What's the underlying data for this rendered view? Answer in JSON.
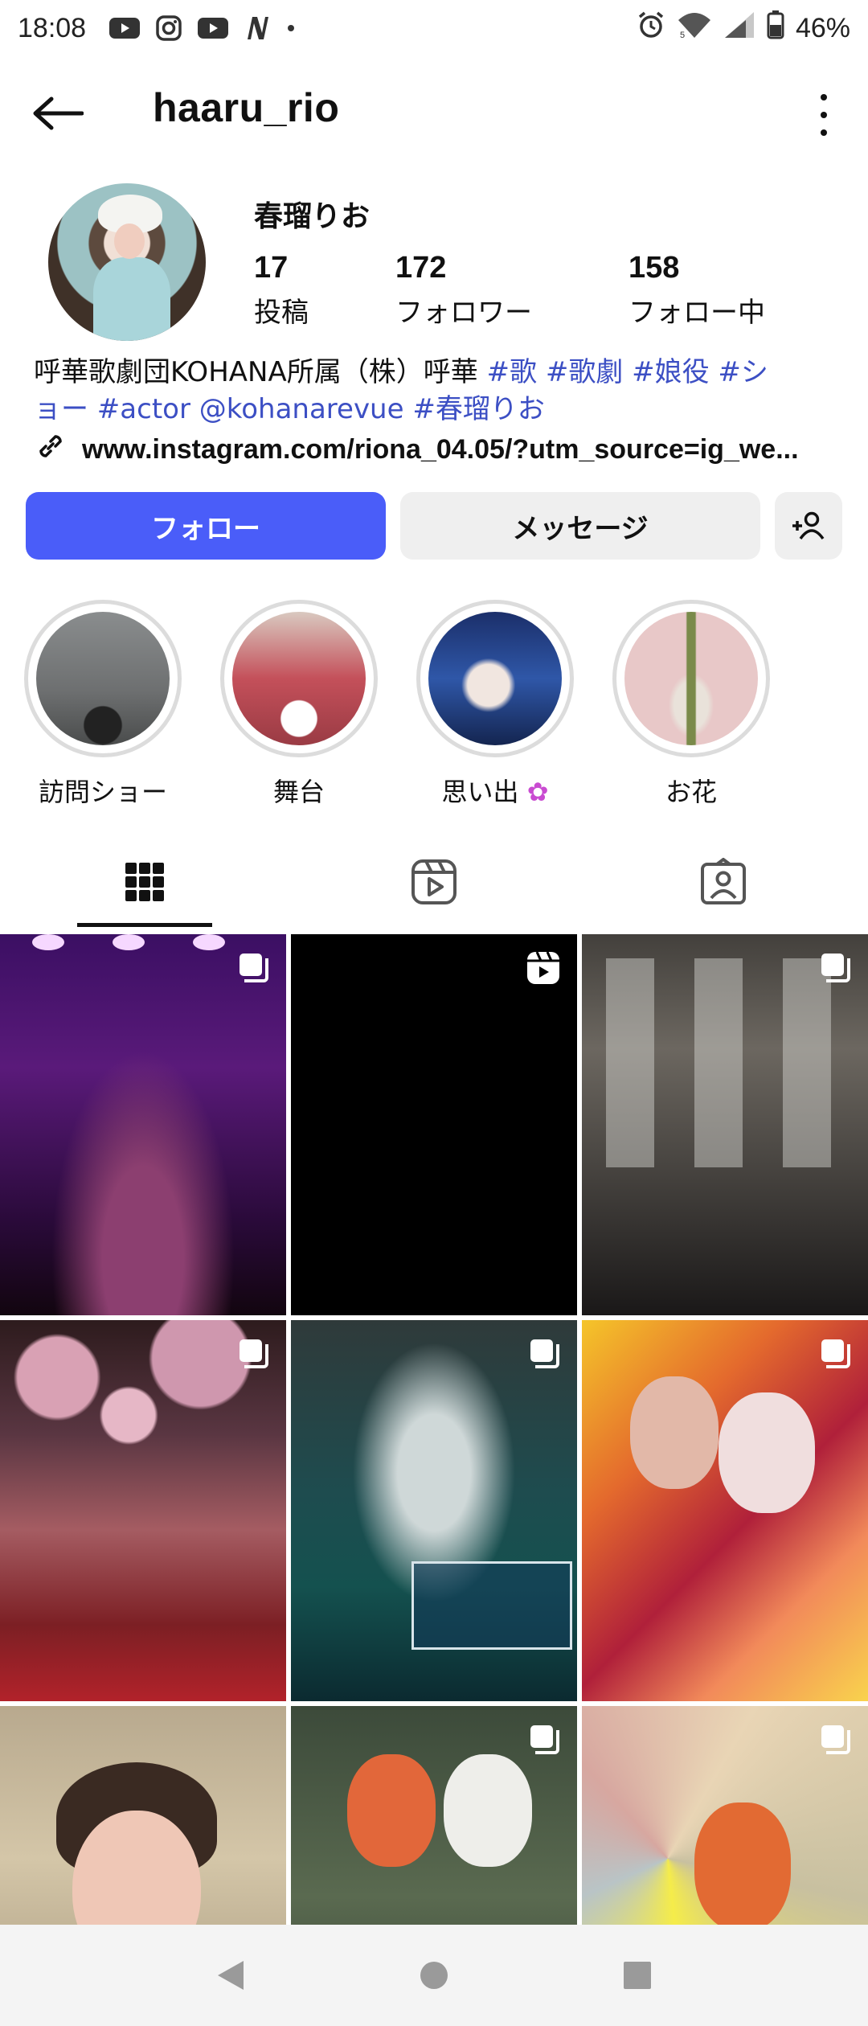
{
  "status_bar": {
    "time": "18:08",
    "notification_icons": [
      "youtube-icon",
      "instagram-icon",
      "youtube-icon",
      "netflix-icon",
      "dot-icon"
    ],
    "system_icons": [
      "alarm-icon",
      "wifi-icon",
      "signal-icon",
      "battery-icon"
    ],
    "battery": "46%"
  },
  "header": {
    "username": "haaru_rio"
  },
  "profile": {
    "display_name": "春瑠りお",
    "stats": [
      {
        "value": "17",
        "label": "投稿"
      },
      {
        "value": "172",
        "label": "フォロワー"
      },
      {
        "value": "158",
        "label": "フォロー中"
      }
    ],
    "bio_line1_plain": "呼華歌劇団KOHANA所属（株）呼華 ",
    "bio_line1_tags": "#歌 #歌劇 #娘役 #シ",
    "bio_line2": "ョー #actor @kohanarevue #春瑠りお",
    "link": "www.instagram.com/riona_04.05/?utm_source=ig_we..."
  },
  "buttons": {
    "follow": "フォロー",
    "message": "メッセージ"
  },
  "highlights": [
    {
      "label": "訪問ショー"
    },
    {
      "label": "舞台"
    },
    {
      "label": "思い出"
    },
    {
      "label": "お花"
    }
  ],
  "tabs": [
    "grid-icon",
    "reels-icon",
    "tagged-icon"
  ],
  "colors": {
    "accent": "#4a5df9",
    "hashtag": "#3c4fc4",
    "secondary_button": "#efefef"
  }
}
